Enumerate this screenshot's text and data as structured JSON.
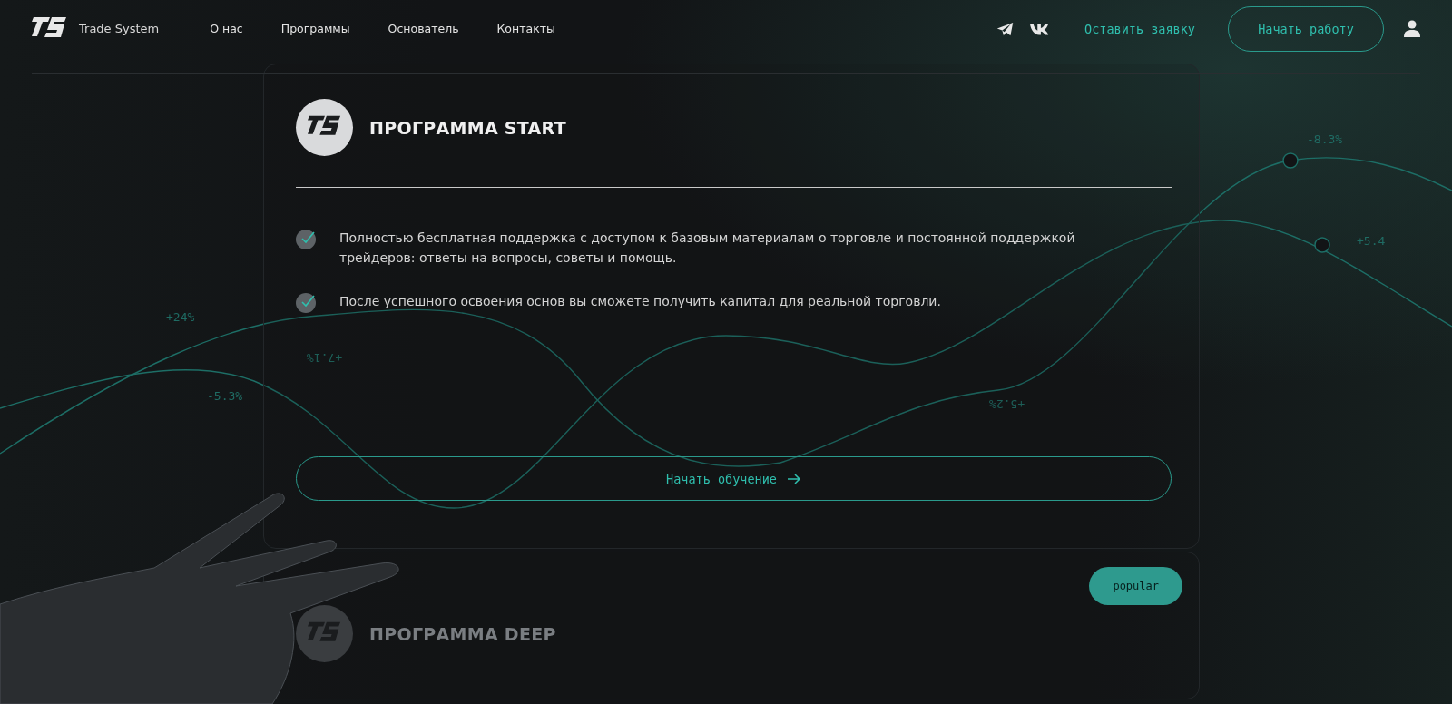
{
  "header": {
    "brand": "Trade System",
    "nav": [
      {
        "label": "О нас"
      },
      {
        "label": "Программы"
      },
      {
        "label": "Основатель"
      },
      {
        "label": "Контакты"
      }
    ],
    "request_link": "Оставить заявку",
    "start_button": "Начать работу"
  },
  "chart_labels": [
    {
      "text": "-8.3%",
      "flipped": false
    },
    {
      "text": "+5.4",
      "flipped": false
    },
    {
      "text": "+24%",
      "flipped": false
    },
    {
      "text": "+7.1%",
      "flipped": true
    },
    {
      "text": "-5.3%",
      "flipped": false
    },
    {
      "text": "+5.2%",
      "flipped": true
    }
  ],
  "programs": [
    {
      "title": "ПРОГРАММА START",
      "faded": false,
      "features": [
        "Полностью бесплатная поддержка с доступом к базовым материалам о торговле и постоянной поддержкой трейдеров: ответы на вопросы, советы и помощь.",
        "После успешного освоения основ вы сможете получить капитал для реальной торговли."
      ],
      "button": "Начать обучение"
    },
    {
      "title": "ПРОГРАММА DEEP",
      "faded": true,
      "badge": "popular"
    }
  ]
}
